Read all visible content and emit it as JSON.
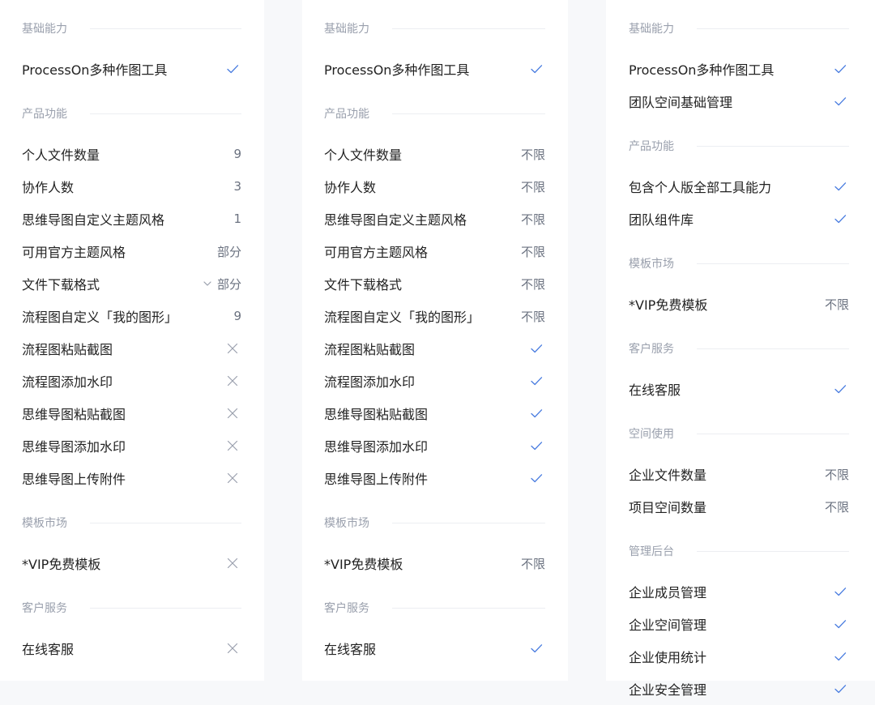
{
  "colors": {
    "check": "#4a7de0",
    "cross": "#9aa0ad"
  },
  "columns": [
    {
      "groups": [
        {
          "title": "基础能力",
          "rows": [
            {
              "label": "ProcessOn多种作图工具",
              "icon": "check-icon"
            }
          ]
        },
        {
          "title": "产品功能",
          "rows": [
            {
              "label": "个人文件数量",
              "value": "9"
            },
            {
              "label": "协作人数",
              "value": "3"
            },
            {
              "label": "思维导图自定义主题风格",
              "value": "1"
            },
            {
              "label": "可用官方主题风格",
              "value": "部分"
            },
            {
              "label": "文件下载格式",
              "value": "部分",
              "chevron": true
            },
            {
              "label": "流程图自定义「我的图形」",
              "value": "9"
            },
            {
              "label": "流程图粘贴截图",
              "icon": "cross-icon"
            },
            {
              "label": "流程图添加水印",
              "icon": "cross-icon"
            },
            {
              "label": "思维导图粘贴截图",
              "icon": "cross-icon"
            },
            {
              "label": "思维导图添加水印",
              "icon": "cross-icon"
            },
            {
              "label": "思维导图上传附件",
              "icon": "cross-icon"
            }
          ]
        },
        {
          "title": "模板市场",
          "rows": [
            {
              "label": "*VIP免费模板",
              "icon": "cross-icon"
            }
          ]
        },
        {
          "title": "客户服务",
          "rows": [
            {
              "label": "在线客服",
              "icon": "cross-icon"
            }
          ]
        }
      ]
    },
    {
      "groups": [
        {
          "title": "基础能力",
          "rows": [
            {
              "label": "ProcessOn多种作图工具",
              "icon": "check-icon"
            }
          ]
        },
        {
          "title": "产品功能",
          "rows": [
            {
              "label": "个人文件数量",
              "value": "不限"
            },
            {
              "label": "协作人数",
              "value": "不限"
            },
            {
              "label": "思维导图自定义主题风格",
              "value": "不限"
            },
            {
              "label": "可用官方主题风格",
              "value": "不限"
            },
            {
              "label": "文件下载格式",
              "value": "不限"
            },
            {
              "label": "流程图自定义「我的图形」",
              "value": "不限"
            },
            {
              "label": "流程图粘贴截图",
              "icon": "check-icon"
            },
            {
              "label": "流程图添加水印",
              "icon": "check-icon"
            },
            {
              "label": "思维导图粘贴截图",
              "icon": "check-icon"
            },
            {
              "label": "思维导图添加水印",
              "icon": "check-icon"
            },
            {
              "label": "思维导图上传附件",
              "icon": "check-icon"
            }
          ]
        },
        {
          "title": "模板市场",
          "rows": [
            {
              "label": "*VIP免费模板",
              "value": "不限"
            }
          ]
        },
        {
          "title": "客户服务",
          "rows": [
            {
              "label": "在线客服",
              "icon": "check-icon"
            }
          ]
        }
      ]
    },
    {
      "groups": [
        {
          "title": "基础能力",
          "rows": [
            {
              "label": "ProcessOn多种作图工具",
              "icon": "check-icon"
            },
            {
              "label": "团队空间基础管理",
              "icon": "check-icon"
            }
          ]
        },
        {
          "title": "产品功能",
          "rows": [
            {
              "label": "包含个人版全部工具能力",
              "icon": "check-icon"
            },
            {
              "label": "团队组件库",
              "icon": "check-icon"
            }
          ]
        },
        {
          "title": "模板市场",
          "rows": [
            {
              "label": "*VIP免费模板",
              "value": "不限"
            }
          ]
        },
        {
          "title": "客户服务",
          "rows": [
            {
              "label": "在线客服",
              "icon": "check-icon"
            }
          ]
        },
        {
          "title": "空间使用",
          "rows": [
            {
              "label": "企业文件数量",
              "value": "不限"
            },
            {
              "label": "项目空间数量",
              "value": "不限"
            }
          ]
        },
        {
          "title": "管理后台",
          "rows": [
            {
              "label": "企业成员管理",
              "icon": "check-icon"
            },
            {
              "label": "企业空间管理",
              "icon": "check-icon"
            },
            {
              "label": "企业使用统计",
              "icon": "check-icon"
            },
            {
              "label": "企业安全管理",
              "icon": "check-icon"
            }
          ]
        }
      ]
    }
  ]
}
